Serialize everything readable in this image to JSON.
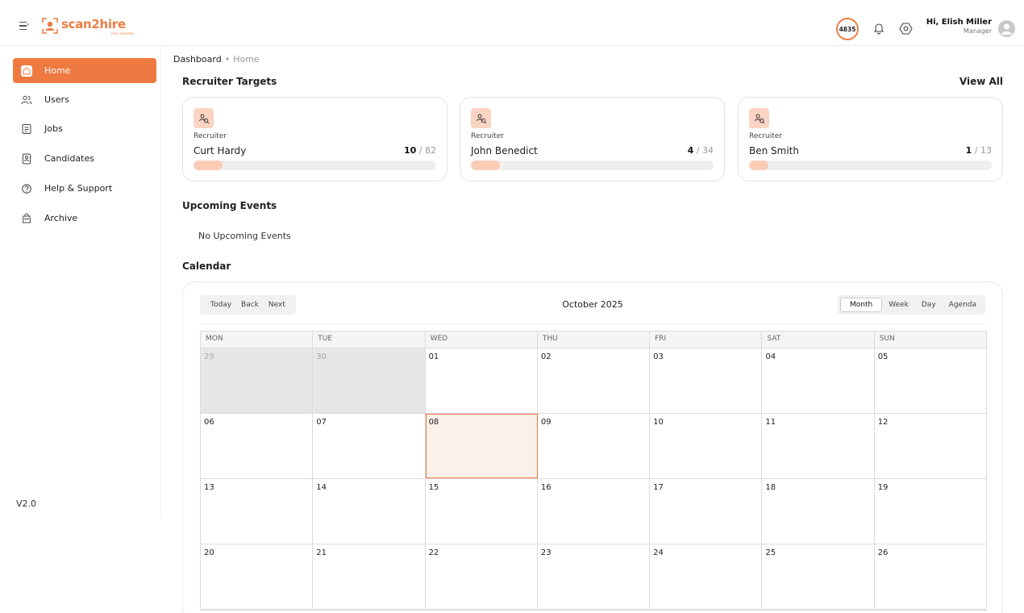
{
  "brand": {
    "name": "scan2hire",
    "tagline": "hire. accurate",
    "accent": "#ee7a41"
  },
  "header": {
    "credits": "4835",
    "greeting": "Hi, Elish Miller",
    "role": "Manager"
  },
  "sidebar": {
    "items": [
      {
        "label": "Home",
        "icon": "home-icon",
        "active": true
      },
      {
        "label": "Users",
        "icon": "users-icon"
      },
      {
        "label": "Jobs",
        "icon": "jobs-icon"
      },
      {
        "label": "Candidates",
        "icon": "candidates-icon"
      },
      {
        "label": "Help & Support",
        "icon": "help-icon"
      },
      {
        "label": "Archive",
        "icon": "archive-icon"
      }
    ],
    "version": "V2.0"
  },
  "breadcrumb": {
    "root": "Dashboard",
    "separator": "•",
    "current": "Home"
  },
  "recruiter_targets": {
    "title": "Recruiter Targets",
    "view_all": "View All",
    "cards": [
      {
        "role": "Recruiter",
        "name": "Curt Hardy",
        "done": "10",
        "total": "82",
        "progress": 0.12
      },
      {
        "role": "Recruiter",
        "name": "John Benedict",
        "done": "4",
        "total": "34",
        "progress": 0.12
      },
      {
        "role": "Recruiter",
        "name": "Ben Smith",
        "done": "1",
        "total": "13",
        "progress": 0.08
      }
    ]
  },
  "upcoming_events": {
    "title": "Upcoming Events",
    "empty": "No Upcoming Events"
  },
  "calendar": {
    "title": "Calendar",
    "nav": {
      "today": "Today",
      "back": "Back",
      "next": "Next"
    },
    "label": "October 2025",
    "views": [
      "Month",
      "Week",
      "Day",
      "Agenda"
    ],
    "active_view": "Month",
    "weekdays": [
      "MON",
      "TUE",
      "WED",
      "THU",
      "FRI",
      "SAT",
      "SUN"
    ],
    "weeks": [
      [
        "29",
        "30",
        "01",
        "02",
        "03",
        "04",
        "05"
      ],
      [
        "06",
        "07",
        "08",
        "09",
        "10",
        "11",
        "12"
      ],
      [
        "13",
        "14",
        "15",
        "16",
        "17",
        "18",
        "19"
      ],
      [
        "20",
        "21",
        "22",
        "23",
        "24",
        "25",
        "26"
      ]
    ],
    "off_month_days": [
      "29",
      "30"
    ],
    "today": "08"
  }
}
